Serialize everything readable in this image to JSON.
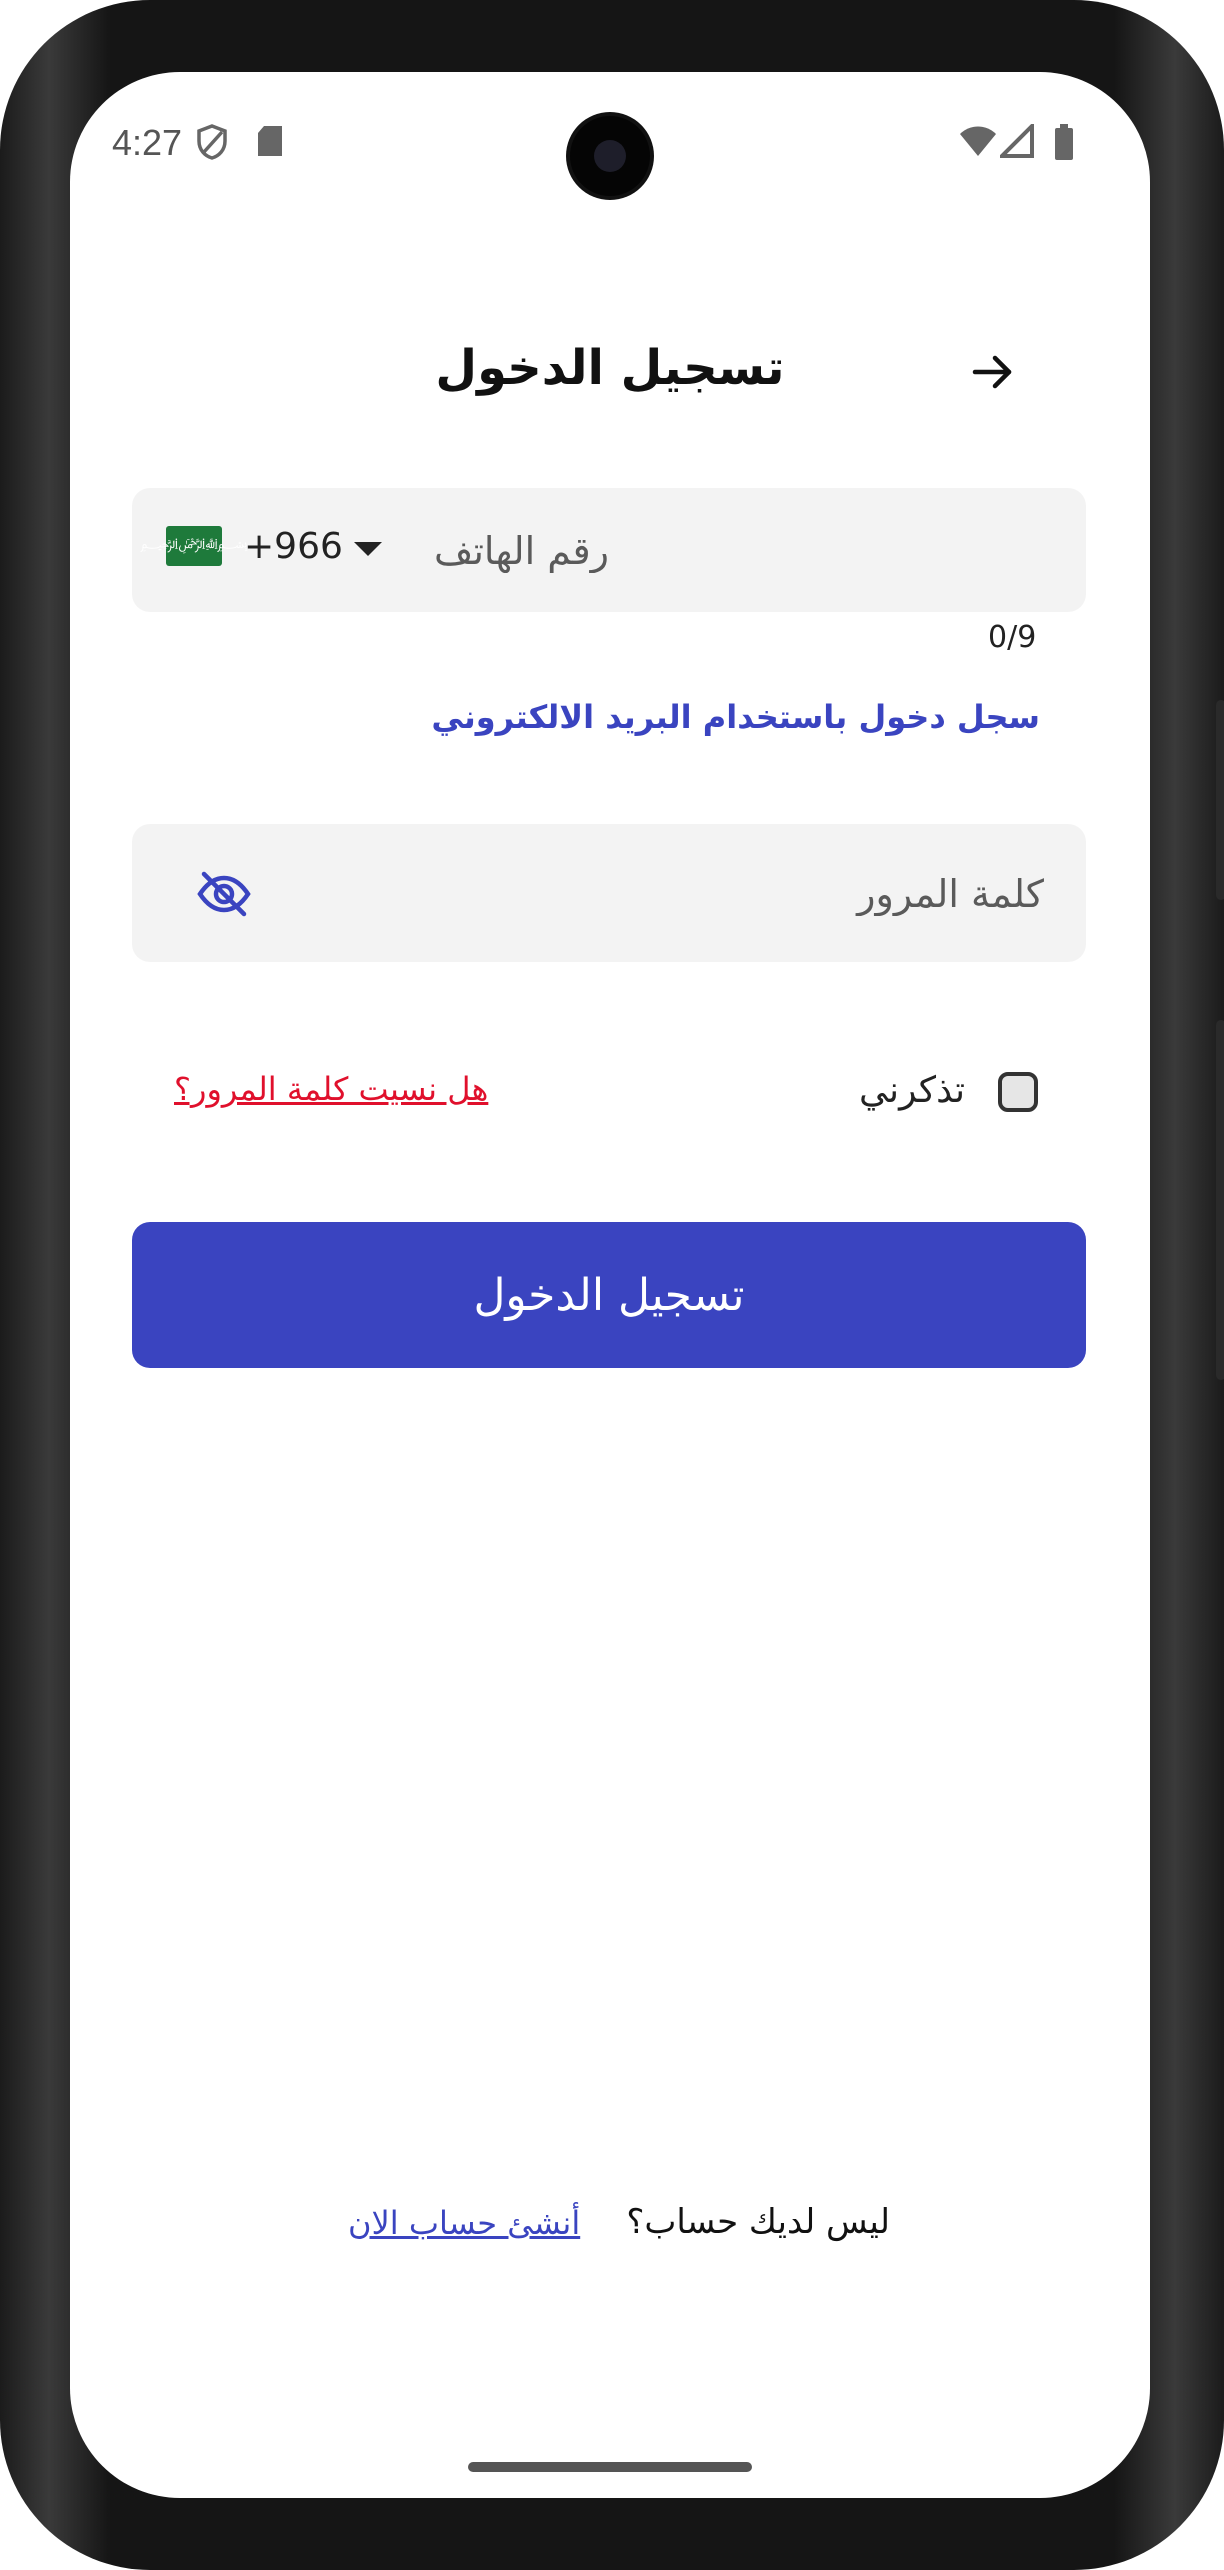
{
  "status_bar": {
    "time": "4:27"
  },
  "header": {
    "title": "تسجيل الدخول",
    "back_icon": "arrow-right-icon"
  },
  "phone": {
    "country_flag": "saudi-flag-icon",
    "country_code": "+966",
    "placeholder": "رقم الهاتف",
    "value": "",
    "counter": "0/9"
  },
  "email_login_link": "سجل دخول باستخدام البريد الالكتروني",
  "password": {
    "placeholder": "كلمة المرور",
    "value": "",
    "toggle_icon": "eye-off-icon"
  },
  "remember_me": {
    "label": "تذكرني",
    "checked": false
  },
  "forgot_password": "هل نسيت كلمة المرور؟",
  "login_button": "تسجيل الدخول",
  "signup": {
    "prompt": "ليس لديك حساب؟",
    "link": "أنشئ حساب الان"
  },
  "colors": {
    "accent": "#3a44c0",
    "danger": "#e0102c",
    "field_bg": "#f3f3f3"
  }
}
